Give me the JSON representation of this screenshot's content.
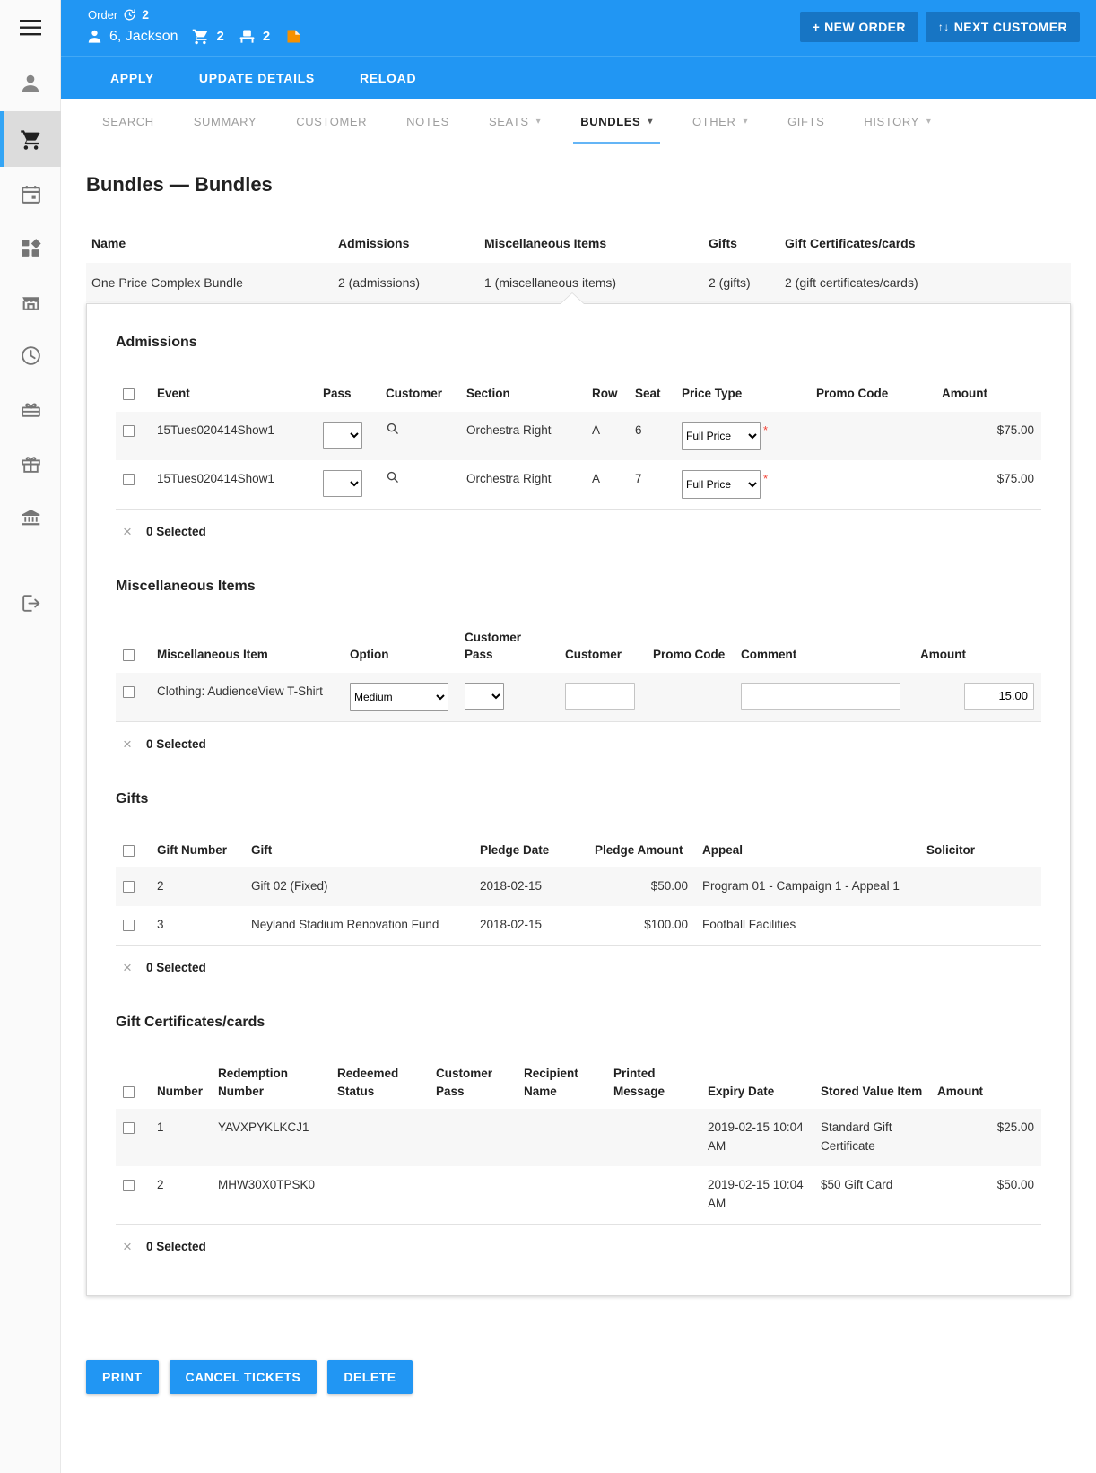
{
  "rail": {
    "items": [
      {
        "name": "hamburger-menu",
        "icon": "hamburger-icon"
      },
      {
        "name": "sidebar-item-customers",
        "icon": "person-icon"
      },
      {
        "name": "sidebar-item-orders",
        "icon": "cart-icon",
        "active": true
      },
      {
        "name": "sidebar-item-events",
        "icon": "calendar-icon"
      },
      {
        "name": "sidebar-item-dashboard",
        "icon": "dashboard-icon"
      },
      {
        "name": "sidebar-item-venue",
        "icon": "store-icon"
      },
      {
        "name": "sidebar-item-history",
        "icon": "clock-icon"
      },
      {
        "name": "sidebar-item-packages",
        "icon": "gift-box-icon"
      },
      {
        "name": "sidebar-item-gifts",
        "icon": "gift-icon"
      },
      {
        "name": "sidebar-item-finance",
        "icon": "bank-icon"
      },
      {
        "name": "sidebar-item-logout",
        "icon": "exit-icon"
      }
    ]
  },
  "header": {
    "order_label": "Order",
    "order_count": "2",
    "customer_name": "6, Jackson",
    "cart_count": "2",
    "seat_count": "2",
    "new_order_label": "NEW ORDER",
    "new_order_plus": "+",
    "next_customer_label": "NEXT CUSTOMER",
    "next_customer_glyph": "↑↓",
    "actions": [
      "APPLY",
      "UPDATE DETAILS",
      "RELOAD"
    ],
    "accent_color": "#2196f3",
    "button_color": "#1775c4",
    "note_icon_color": "#f59000"
  },
  "tabs": [
    {
      "label": "SEARCH",
      "caret": false,
      "active": false
    },
    {
      "label": "SUMMARY",
      "caret": false,
      "active": false
    },
    {
      "label": "CUSTOMER",
      "caret": false,
      "active": false
    },
    {
      "label": "NOTES",
      "caret": false,
      "active": false
    },
    {
      "label": "SEATS",
      "caret": true,
      "active": false
    },
    {
      "label": "BUNDLES",
      "caret": true,
      "active": true
    },
    {
      "label": "OTHER",
      "caret": true,
      "active": false
    },
    {
      "label": "GIFTS",
      "caret": false,
      "active": false
    },
    {
      "label": "HISTORY",
      "caret": true,
      "active": false
    }
  ],
  "page": {
    "title": "Bundles — Bundles"
  },
  "summary": {
    "headers": [
      "Name",
      "Admissions",
      "Miscellaneous Items",
      "Gifts",
      "Gift Certificates/cards"
    ],
    "row": {
      "name": "One Price Complex Bundle",
      "admissions": "2 (admissions)",
      "misc": "1 (miscellaneous items)",
      "gifts": "2 (gifts)",
      "certs": "2 (gift certificates/cards)"
    }
  },
  "admissions": {
    "title": "Admissions",
    "headers": [
      "Event",
      "Pass",
      "Customer",
      "Section",
      "Row",
      "Seat",
      "Price Type",
      "Promo Code",
      "Amount"
    ],
    "rows": [
      {
        "event": "15Tues020414Show1",
        "pass": "",
        "section": "Orchestra Right",
        "row": "A",
        "seat": "6",
        "price_type": "Full Price",
        "promo": "",
        "amount": "$75.00"
      },
      {
        "event": "15Tues020414Show1",
        "pass": "",
        "section": "Orchestra Right",
        "row": "A",
        "seat": "7",
        "price_type": "Full Price",
        "promo": "",
        "amount": "$75.00"
      }
    ],
    "selected": "0 Selected"
  },
  "misc": {
    "title": "Miscellaneous Items",
    "headers": [
      "Miscellaneous Item",
      "Option",
      "Customer Pass",
      "Customer",
      "Promo Code",
      "Comment",
      "Amount"
    ],
    "rows": [
      {
        "item": "Clothing: AudienceView T-Shirt",
        "option": "Medium",
        "customer_pass": "",
        "customer": "",
        "promo": "",
        "comment": "",
        "amount": "15.00"
      }
    ],
    "selected": "0 Selected"
  },
  "gifts": {
    "title": "Gifts",
    "headers": [
      "Gift Number",
      "Gift",
      "Pledge Date",
      "Pledge Amount",
      "Appeal",
      "Solicitor"
    ],
    "rows": [
      {
        "number": "2",
        "gift": "Gift 02 (Fixed)",
        "pledge_date": "2018-02-15",
        "pledge_amount": "$50.00",
        "appeal": "Program 01 - Campaign 1 - Appeal 1",
        "solicitor": ""
      },
      {
        "number": "3",
        "gift": "Neyland Stadium Renovation Fund",
        "pledge_date": "2018-02-15",
        "pledge_amount": "$100.00",
        "appeal": "Football Facilities",
        "solicitor": ""
      }
    ],
    "selected": "0 Selected"
  },
  "certificates": {
    "title": "Gift Certificates/cards",
    "headers": [
      "Number",
      "Redemption\nNumber",
      "Redeemed\nStatus",
      "Customer\nPass",
      "Recipient\nName",
      "Printed\nMessage",
      "Expiry Date",
      "Stored Value Item",
      "Amount"
    ],
    "rows": [
      {
        "number": "1",
        "redemption": "YAVXPYKLKCJ1",
        "redeemed_status": "",
        "customer_pass": "",
        "recipient": "",
        "printed_message": "",
        "expiry": "2019-02-15 10:04\nAM",
        "stored_value": "Standard Gift\nCertificate",
        "amount": "$25.00"
      },
      {
        "number": "2",
        "redemption": "MHW30X0TPSK0",
        "redeemed_status": "",
        "customer_pass": "",
        "recipient": "",
        "printed_message": "",
        "expiry": "2019-02-15 10:04\nAM",
        "stored_value": "$50 Gift Card",
        "amount": "$50.00"
      }
    ],
    "selected": "0 Selected"
  },
  "footer": {
    "buttons": [
      "PRINT",
      "CANCEL TICKETS",
      "DELETE"
    ]
  }
}
